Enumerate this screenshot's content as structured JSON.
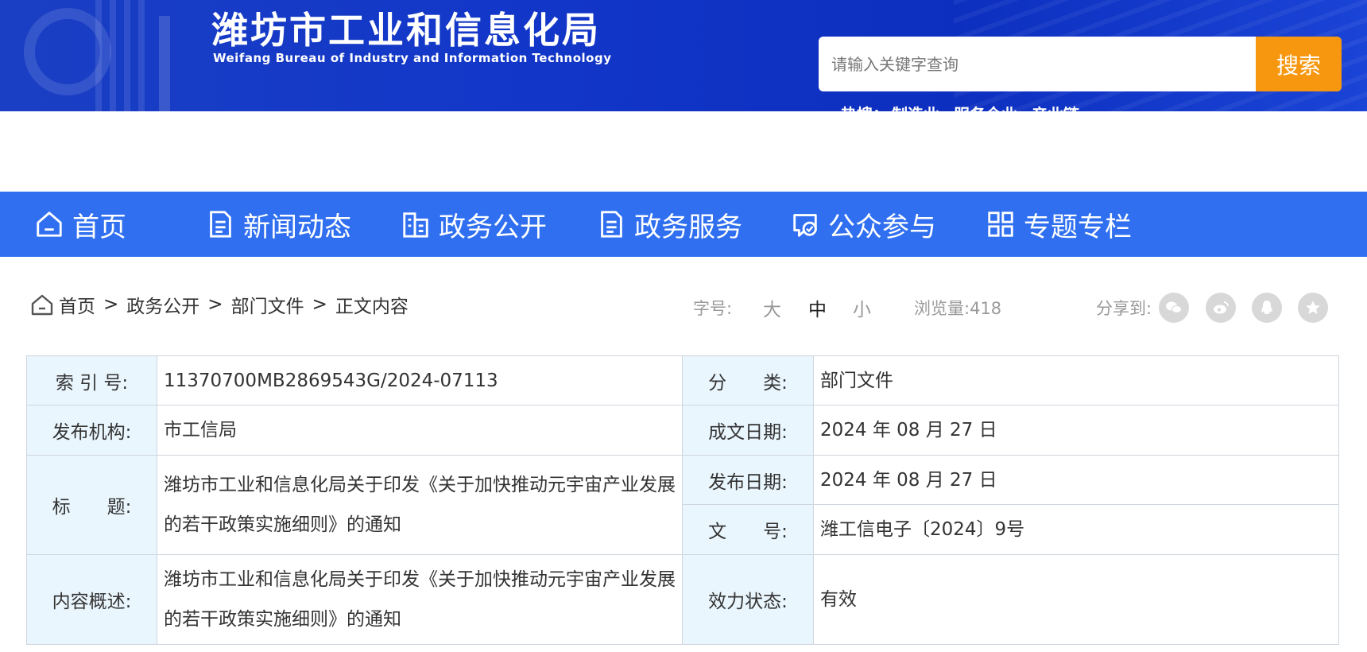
{
  "header": {
    "title": "潍坊市工业和信息化局",
    "subtitle": "Weifang Bureau of Industry and Information Technology",
    "search_placeholder": "请输入关键字查询",
    "search_button": "搜索",
    "hot_search_label": "热搜：",
    "hot_search_items": [
      "制造业",
      "服务企业",
      "产业链"
    ]
  },
  "nav": {
    "items": [
      {
        "label": "首页",
        "icon": "home-icon"
      },
      {
        "label": "新闻动态",
        "icon": "document-icon"
      },
      {
        "label": "政务公开",
        "icon": "building-icon"
      },
      {
        "label": "政务服务",
        "icon": "document-icon"
      },
      {
        "label": "公众参与",
        "icon": "chat-check-icon"
      },
      {
        "label": "专题专栏",
        "icon": "grid-icon"
      }
    ]
  },
  "breadcrumb": {
    "items": [
      "首页",
      "政务公开",
      "部门文件",
      "正文内容"
    ],
    "separator": ">"
  },
  "toolbar": {
    "font_size_label": "字号:",
    "font_sizes": [
      "大",
      "中",
      "小"
    ],
    "selected_font_size": "中",
    "views_label": "浏览量:",
    "views_count": "418",
    "share_label": "分享到:",
    "share_icons": [
      "wechat-icon",
      "weibo-icon",
      "qq-icon",
      "favorite-star-icon"
    ]
  },
  "info": {
    "index_label": "索 引 号:",
    "index_value": "11370700MB2869543G/2024-07113",
    "category_label": "分　　类:",
    "category_value": "部门文件",
    "publisher_label": "发布机构:",
    "publisher_value": "市工信局",
    "written_date_label": "成文日期:",
    "written_date_value": "2024 年 08 月 27 日",
    "title_label": "标　　题:",
    "title_value": "潍坊市工业和信息化局关于印发《关于加快推动元宇宙产业发展的若干政策实施细则》的通知",
    "publish_date_label": "发布日期:",
    "publish_date_value": "2024 年 08 月 27 日",
    "doc_no_label": "文　　号:",
    "doc_no_value": "潍工信电子〔2024〕9号",
    "summary_label": "内容概述:",
    "summary_value": "潍坊市工业和信息化局关于印发《关于加快推动元宇宙产业发展的若干政策实施细则》的通知",
    "validity_label": "效力状态:",
    "validity_value": "有效"
  },
  "colors": {
    "nav_bg": "#2f6ff0",
    "search_button": "#f7970f",
    "label_cell_bg": "#eaf6fd",
    "banner_bg": "#1236c8"
  }
}
